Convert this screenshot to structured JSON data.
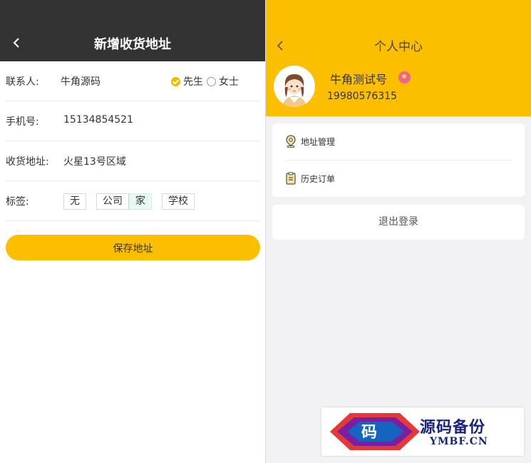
{
  "left": {
    "header": {
      "title": "新增收货地址"
    },
    "contact": {
      "label": "联系人:",
      "value": "牛角源码"
    },
    "gender": {
      "options": [
        "先生",
        "女士"
      ],
      "selected": "先生"
    },
    "phone": {
      "label": "手机号:",
      "value": "15134854521"
    },
    "address": {
      "label": "收货地址:",
      "value": "火星13号区域"
    },
    "tags": {
      "label": "标签:",
      "items": [
        "无",
        "公司",
        "家",
        "学校"
      ],
      "selected": "家"
    },
    "save_label": "保存地址"
  },
  "right": {
    "header": {
      "title": "个人中心"
    },
    "user": {
      "name": "牛角测试号",
      "phone": "19980576315"
    },
    "menu": [
      {
        "label": "地址管理",
        "icon": "location-pin-icon"
      },
      {
        "label": "历史订单",
        "icon": "clipboard-icon"
      }
    ],
    "logout_label": "退出登录"
  },
  "watermark": {
    "char": "码",
    "cn": "源码备份",
    "en": "YMBF.CN"
  },
  "colors": {
    "accent": "#fbbf00",
    "dark_header": "#333333",
    "tag_active": "#e6fbf3"
  }
}
